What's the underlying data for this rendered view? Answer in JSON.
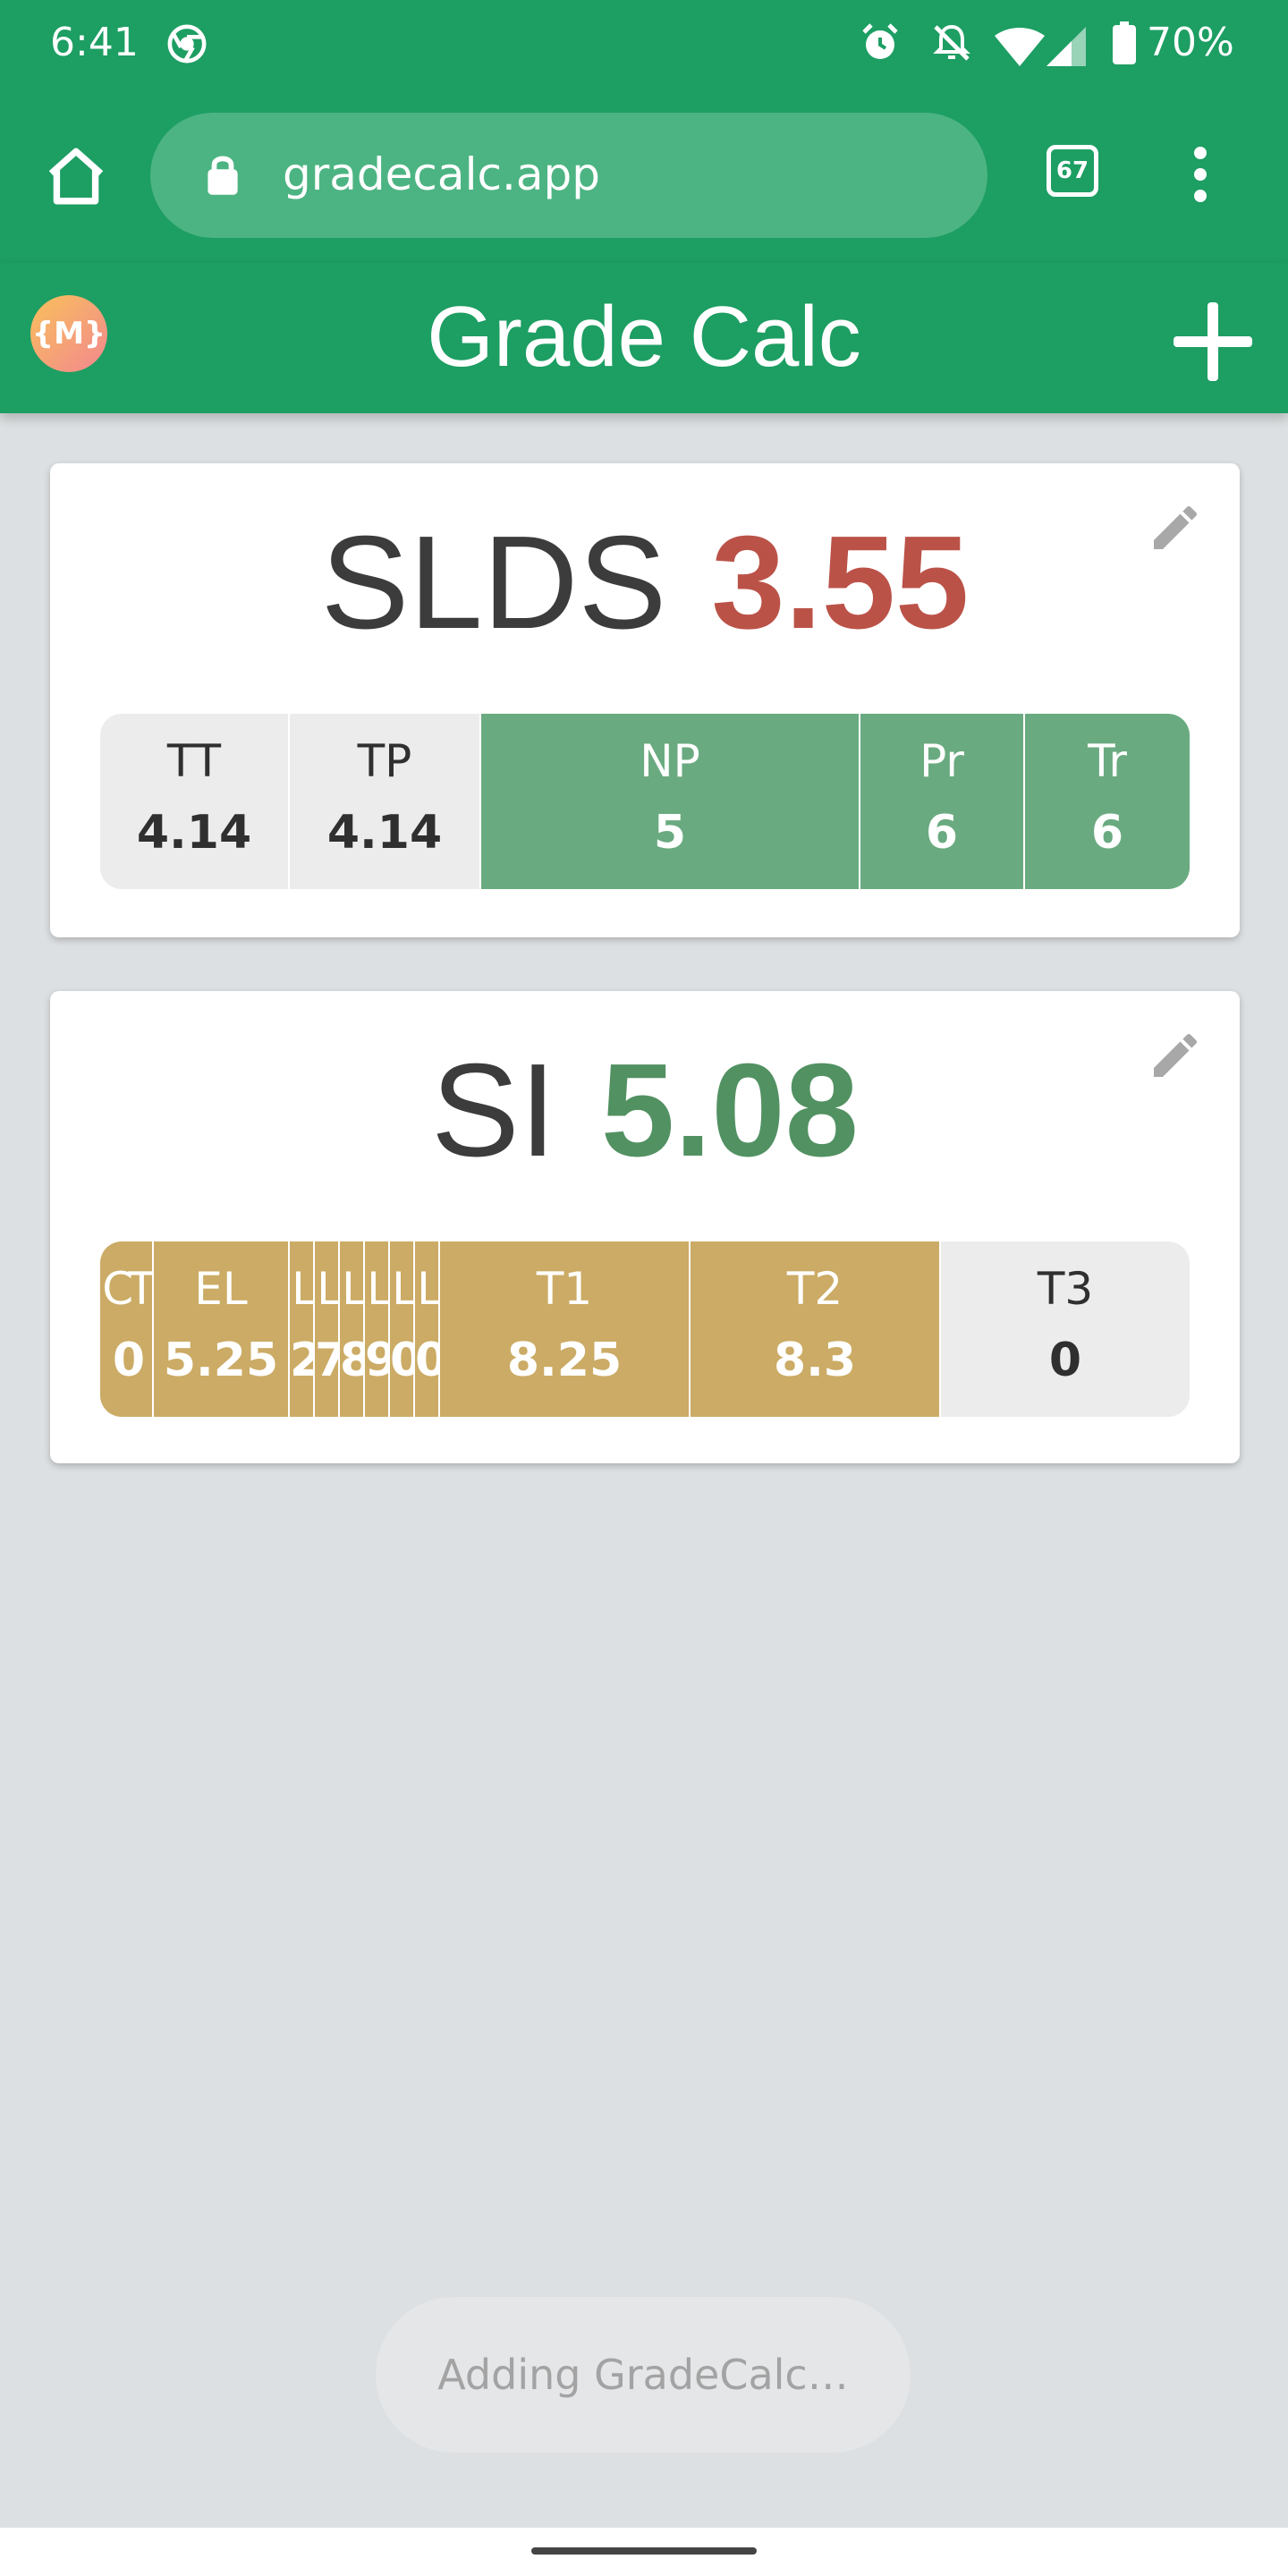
{
  "status_bar": {
    "time": "6:41",
    "battery": "70%",
    "icons": [
      "chrome-icon",
      "alarm-icon",
      "bell-off-icon",
      "wifi-icon",
      "signal-icon",
      "battery-icon"
    ]
  },
  "browser": {
    "url": "gradecalc.app",
    "tab_count": "67",
    "icons": [
      "home-icon",
      "lock-icon",
      "tabs-icon",
      "more-vert-icon"
    ]
  },
  "app_bar": {
    "logo_text": "{M}",
    "title": "Grade Calc",
    "icons": [
      "logo-icon",
      "plus-icon"
    ]
  },
  "courses": [
    {
      "name": "SLDS",
      "grade": "3.55",
      "grade_color": "#bb5248",
      "components": [
        {
          "label": "TT",
          "value": "4.14",
          "style": "grey"
        },
        {
          "label": "TP",
          "value": "4.14",
          "style": "grey"
        },
        {
          "label": "NP",
          "value": "5",
          "style": "green"
        },
        {
          "label": "Pr",
          "value": "6",
          "style": "green"
        },
        {
          "label": "Tr",
          "value": "6",
          "style": "green"
        }
      ]
    },
    {
      "name": "SI",
      "grade": "5.08",
      "grade_color": "#529162",
      "components": [
        {
          "label": "CT",
          "value": "0",
          "style": "gold"
        },
        {
          "label": "EL",
          "value": "5.25",
          "style": "gold"
        },
        {
          "label": "L",
          "value": "2",
          "style": "gold"
        },
        {
          "label": "L",
          "value": "7",
          "style": "gold"
        },
        {
          "label": "L",
          "value": "8",
          "style": "gold"
        },
        {
          "label": "L",
          "value": "9",
          "style": "gold"
        },
        {
          "label": "L",
          "value": "0",
          "style": "gold"
        },
        {
          "label": "L",
          "value": "0",
          "style": "gold"
        },
        {
          "label": "T1",
          "value": "8.25",
          "style": "gold"
        },
        {
          "label": "T2",
          "value": "8.3",
          "style": "gold"
        },
        {
          "label": "T3",
          "value": "0",
          "style": "grey"
        }
      ]
    }
  ],
  "toast": "Adding GradeCalc…",
  "colors": {
    "primary": "#1d9e63",
    "url_bar": "#4cb482",
    "background": "#dde0e2",
    "segment_green": "#6aaa80",
    "segment_gold": "#cbab65",
    "segment_grey": "#ececec"
  }
}
